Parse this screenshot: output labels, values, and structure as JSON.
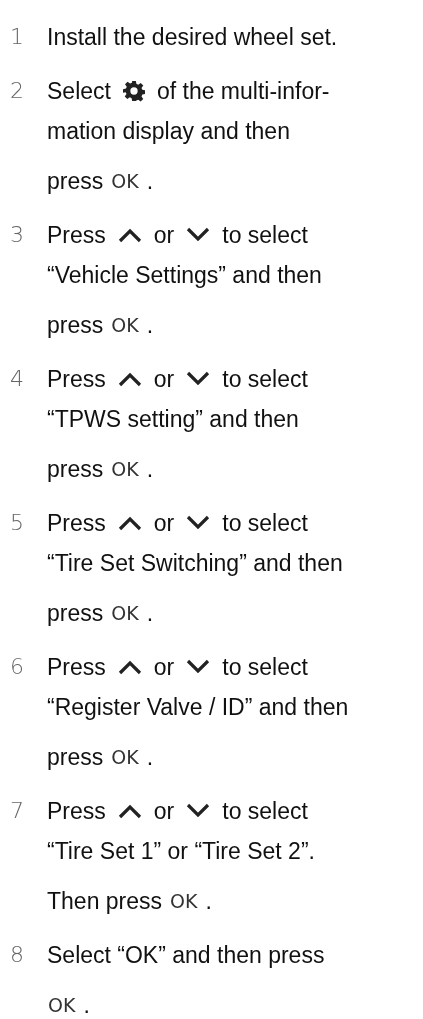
{
  "steps": [
    {
      "number": "1",
      "lines": [
        [
          {
            "kind": "text",
            "text": "Install the desired wheel set."
          }
        ]
      ]
    },
    {
      "number": "2",
      "lines": [
        [
          {
            "kind": "text",
            "text": "Select"
          },
          {
            "kind": "gear"
          },
          {
            "kind": "text",
            "text": "of the multi-infor-"
          }
        ],
        [
          {
            "kind": "text",
            "text": "mation display and then"
          }
        ],
        [
          {
            "kind": "text",
            "text": "press"
          },
          {
            "kind": "key",
            "text": "OK"
          },
          {
            "kind": "text",
            "text": "."
          }
        ]
      ]
    },
    {
      "number": "3",
      "lines": [
        [
          {
            "kind": "text",
            "text": "Press"
          },
          {
            "kind": "up"
          },
          {
            "kind": "text",
            "text": "or"
          },
          {
            "kind": "down"
          },
          {
            "kind": "text",
            "text": "to select"
          }
        ],
        [
          {
            "kind": "text",
            "text": "“Vehicle Settings” and then"
          }
        ],
        [
          {
            "kind": "text",
            "text": "press"
          },
          {
            "kind": "key",
            "text": "OK"
          },
          {
            "kind": "text",
            "text": "."
          }
        ]
      ]
    },
    {
      "number": "4",
      "lines": [
        [
          {
            "kind": "text",
            "text": "Press"
          },
          {
            "kind": "up"
          },
          {
            "kind": "text",
            "text": "or"
          },
          {
            "kind": "down"
          },
          {
            "kind": "text",
            "text": "to select"
          }
        ],
        [
          {
            "kind": "text",
            "text": "“TPWS setting” and then"
          }
        ],
        [
          {
            "kind": "text",
            "text": "press"
          },
          {
            "kind": "key",
            "text": "OK"
          },
          {
            "kind": "text",
            "text": "."
          }
        ]
      ]
    },
    {
      "number": "5",
      "lines": [
        [
          {
            "kind": "text",
            "text": "Press"
          },
          {
            "kind": "up"
          },
          {
            "kind": "text",
            "text": "or"
          },
          {
            "kind": "down"
          },
          {
            "kind": "text",
            "text": "to select"
          }
        ],
        [
          {
            "kind": "text",
            "text": "“Tire Set Switching” and then"
          }
        ],
        [
          {
            "kind": "text",
            "text": "press"
          },
          {
            "kind": "key",
            "text": "OK"
          },
          {
            "kind": "text",
            "text": "."
          }
        ]
      ]
    },
    {
      "number": "6",
      "lines": [
        [
          {
            "kind": "text",
            "text": "Press"
          },
          {
            "kind": "up"
          },
          {
            "kind": "text",
            "text": "or"
          },
          {
            "kind": "down"
          },
          {
            "kind": "text",
            "text": "to select"
          }
        ],
        [
          {
            "kind": "text",
            "text": "“Register Valve / ID” and then"
          }
        ],
        [
          {
            "kind": "text",
            "text": "press"
          },
          {
            "kind": "key",
            "text": "OK"
          },
          {
            "kind": "text",
            "text": "."
          }
        ]
      ]
    },
    {
      "number": "7",
      "lines": [
        [
          {
            "kind": "text",
            "text": "Press"
          },
          {
            "kind": "up"
          },
          {
            "kind": "text",
            "text": "or"
          },
          {
            "kind": "down"
          },
          {
            "kind": "text",
            "text": "to select"
          }
        ],
        [
          {
            "kind": "text",
            "text": "“Tire Set 1” or “Tire Set 2”."
          }
        ],
        [
          {
            "kind": "text",
            "text": "Then press"
          },
          {
            "kind": "key",
            "text": "OK"
          },
          {
            "kind": "text",
            "text": "."
          }
        ]
      ]
    },
    {
      "number": "8",
      "lines": [
        [
          {
            "kind": "text",
            "text": "Select “OK” and then press"
          }
        ],
        [
          {
            "kind": "key",
            "text": "OK"
          },
          {
            "kind": "text",
            "text": "."
          }
        ]
      ]
    }
  ]
}
